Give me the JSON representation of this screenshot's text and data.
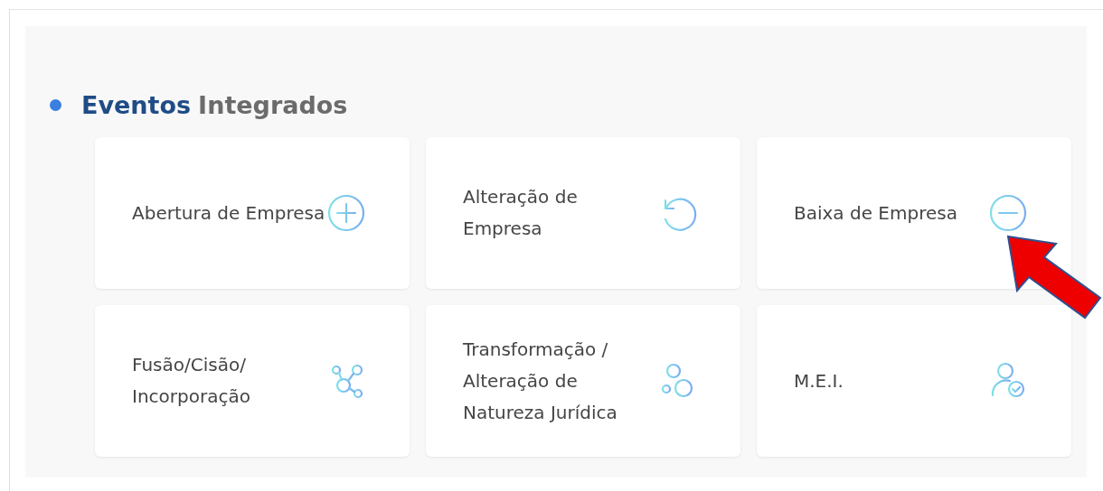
{
  "heading": {
    "primary": "Eventos",
    "secondary": "Integrados"
  },
  "cards": [
    {
      "label": "Abertura de Empresa",
      "kind": "plus"
    },
    {
      "label": "Alteração de Empresa",
      "kind": "undo"
    },
    {
      "label": "Baixa de Empresa",
      "kind": "minus"
    },
    {
      "label": "Fusão/Cisão/ Incorporação",
      "kind": "network"
    },
    {
      "label": "Transformação / Alteração de Natureza Jurídica",
      "kind": "circles"
    },
    {
      "label": "M.E.I.",
      "kind": "user-check"
    }
  ]
}
